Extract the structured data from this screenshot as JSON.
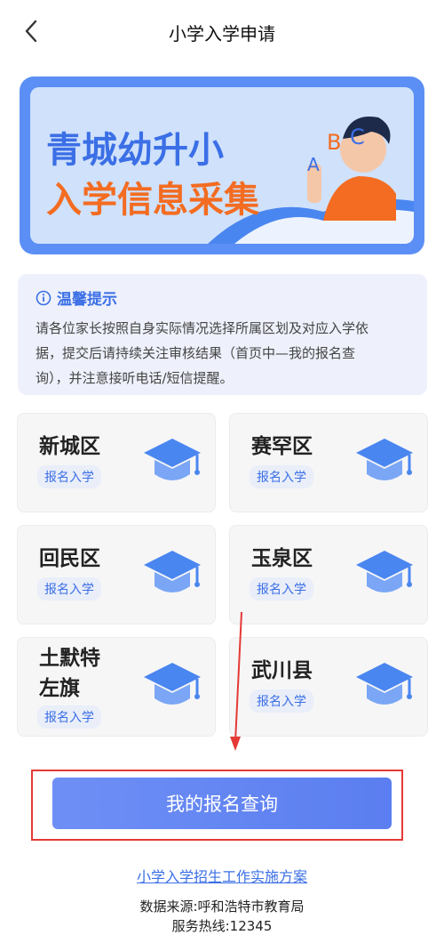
{
  "header": {
    "title": "小学入学申请",
    "back_icon": "chevron-left-icon"
  },
  "banner": {
    "line1": "青城幼升小",
    "line2": "入学信息采集",
    "letters": [
      "A",
      "B",
      "C"
    ],
    "colors": {
      "line1": "#3b6fe6",
      "line2": "#f36c21",
      "bg": "#cfe1fb",
      "frame": "#5b8ff5"
    }
  },
  "tips": {
    "icon": "info-circle-icon",
    "title": "温馨提示",
    "lines": [
      "请各位家长按照自身实际情况选择所属区划及对应入学依",
      "据，提交后请持续关注审核结果（首页中—我的报名查",
      "询），并注意接听电话/短信提醒。"
    ]
  },
  "districts": [
    {
      "name": "新城区",
      "tag": "报名入学"
    },
    {
      "name": "赛罕区",
      "tag": "报名入学"
    },
    {
      "name": "回民区",
      "tag": "报名入学"
    },
    {
      "name": "玉泉区",
      "tag": "报名入学"
    },
    {
      "name": "土默特左旗",
      "name_line1": "土默特",
      "name_line2": "左旗",
      "tag": "报名入学"
    },
    {
      "name": "武川县",
      "tag": "报名入学"
    }
  ],
  "query_button": {
    "label": "我的报名查询"
  },
  "footer": {
    "plan_link": "小学入学招生工作实施方案",
    "source": "数据来源:呼和浩特市教育局",
    "hotline": "服务热线:12345"
  },
  "colors": {
    "accent": "#3b6fe6",
    "highlight": "#e53935"
  }
}
